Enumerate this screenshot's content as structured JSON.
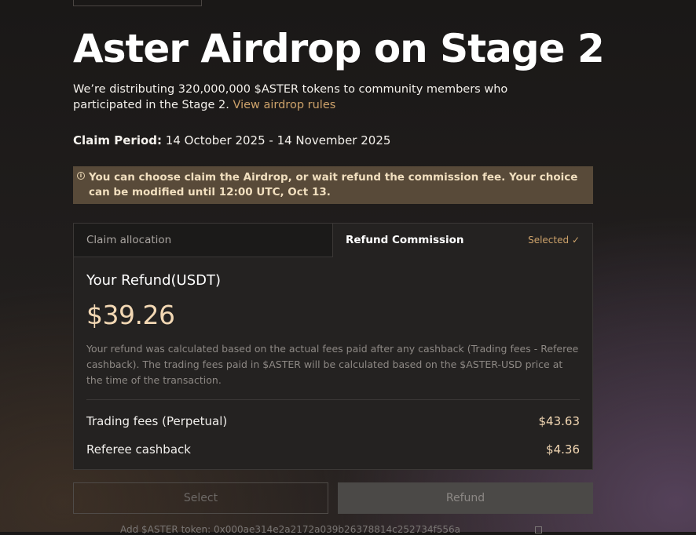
{
  "header": {
    "title": "Aster Airdrop on Stage 2",
    "description": "We’re distributing 320,000,000 $ASTER tokens to community members who participated in the Stage 2.",
    "rules_link": "View airdrop rules",
    "claim_period_label": "Claim Period",
    "claim_period_value": "14 October 2025 - 14 November 2025"
  },
  "notice": {
    "icon": "info-icon",
    "text": "You can choose claim the Airdrop, or wait refund the commission fee. Your choice can be modified until 12:00 UTC, Oct 13."
  },
  "tabs": [
    {
      "label": "Claim allocation",
      "active": false
    },
    {
      "label": "Refund Commission",
      "active": true,
      "status": "Selected"
    }
  ],
  "refund": {
    "title": "Your Refund(USDT)",
    "amount": "$39.26",
    "note": "Your refund was calculated based on the actual fees paid after any cashback (Trading fees - Referee cashback). The trading fees paid in $ASTER will be calculated based on the $ASTER-USD price at the time of the transaction.",
    "rows": [
      {
        "label": "Trading fees (Perpetual)",
        "value": "$43.63"
      },
      {
        "label": "Referee cashback",
        "value": "$4.36"
      }
    ]
  },
  "buttons": {
    "select": "Select",
    "refund": "Refund"
  },
  "footer": {
    "text": "Add $ASTER token: 0x000ae314e2a2172a039b26378814c252734f556a"
  },
  "colors": {
    "accent": "#cda26a",
    "amount": "#f3d8b4",
    "notice_bg": "#584a39"
  }
}
